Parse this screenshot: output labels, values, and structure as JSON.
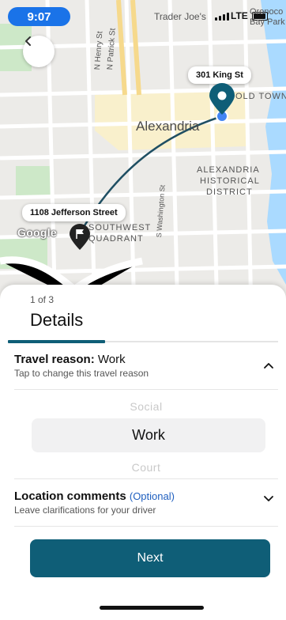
{
  "status_bar": {
    "time": "9:07",
    "network": "LTE"
  },
  "map": {
    "place_labels": {
      "trader_joes": "Trader Joe's",
      "oronoco": "Oronoco",
      "bay_park": "Bay Park",
      "n_henry": "N Henry St",
      "n_patrick": "N Patrick St",
      "alexandria": "Alexandria",
      "old_town": "OLD TOWN",
      "historic_1": "ALEXANDRIA",
      "historic_2": "HISTORICAL",
      "historic_3": "DISTRICT",
      "southwest": "SOUTHWEST",
      "quadrant": "QUADRANT",
      "s_washington": "S Washington St"
    },
    "destination_label": "301 King St",
    "origin_label": "1108 Jefferson Street",
    "attribution": "Google",
    "icons": {
      "back": "chevron-left-icon",
      "destination": "location-pin-icon",
      "origin": "flag-icon"
    },
    "colors": {
      "route": "#1f4f63",
      "pin": "#0f5e77"
    }
  },
  "sheet": {
    "step": "1 of 3",
    "title": "Details",
    "progress_fraction": 0.36,
    "travel_reason": {
      "label": "Travel reason:",
      "value": "Work",
      "hint": "Tap to change this travel reason",
      "expanded": true
    },
    "picker": {
      "prev": "Social",
      "selected": "Work",
      "next": "Court"
    },
    "location_comments": {
      "label": "Location comments",
      "optional": "(Optional)",
      "hint": "Leave clarifications for your driver",
      "expanded": false
    },
    "next_button": "Next",
    "accent_color": "#0f5e77"
  }
}
